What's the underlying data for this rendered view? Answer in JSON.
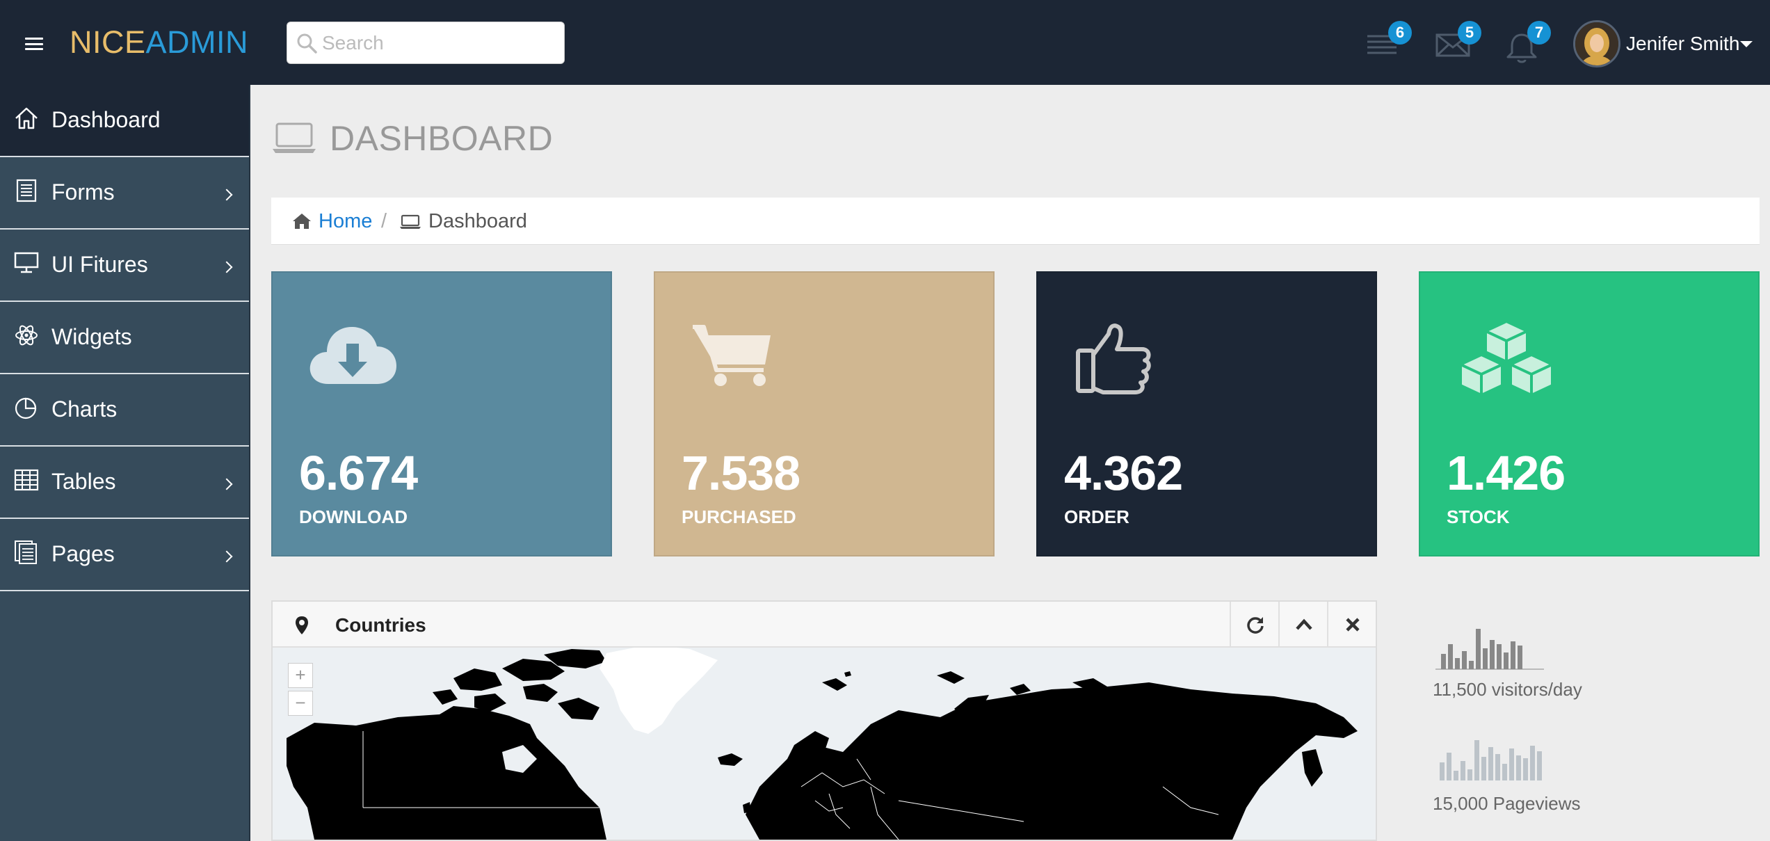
{
  "brand": {
    "part1": "NICE",
    "part2": "ADMIN"
  },
  "search": {
    "placeholder": "Search"
  },
  "header": {
    "tasks_badge": "6",
    "messages_badge": "5",
    "notifications_badge": "7",
    "user_name": "Jenifer Smith"
  },
  "sidebar": {
    "items": [
      {
        "label": "Dashboard",
        "icon": "home-icon",
        "active": true,
        "submenu": false
      },
      {
        "label": "Forms",
        "icon": "document-icon",
        "submenu": true
      },
      {
        "label": "UI Fitures",
        "icon": "desktop-icon",
        "submenu": true
      },
      {
        "label": "Widgets",
        "icon": "atom-icon",
        "submenu": false
      },
      {
        "label": "Charts",
        "icon": "pie-chart-icon",
        "submenu": false
      },
      {
        "label": "Tables",
        "icon": "table-icon",
        "submenu": true
      },
      {
        "label": "Pages",
        "icon": "pages-icon",
        "submenu": true
      }
    ]
  },
  "page": {
    "title": "DASHBOARD"
  },
  "breadcrumb": {
    "home": "Home",
    "separator": "/",
    "current": "Dashboard"
  },
  "tiles": [
    {
      "value": "6.674",
      "label": "DOWNLOAD",
      "icon": "cloud-download-icon",
      "color": "#5a8a9f"
    },
    {
      "value": "7.538",
      "label": "PURCHASED",
      "icon": "shopping-cart-icon",
      "color": "#d0b791"
    },
    {
      "value": "4.362",
      "label": "ORDER",
      "icon": "thumbs-up-icon",
      "color": "#1c2635"
    },
    {
      "value": "1.426",
      "label": "STOCK",
      "icon": "cubes-icon",
      "color": "#26c281"
    }
  ],
  "countries_panel": {
    "title": "Countries",
    "zoom_in": "+",
    "zoom_out": "−"
  },
  "stats": [
    {
      "text": "11,500 visitors/day"
    },
    {
      "text": "15,000 Pageviews"
    }
  ],
  "colors": {
    "header_bg": "#1c2635",
    "sidebar_bg": "#364b5b",
    "accent_blue": "#1692d4",
    "link_blue": "#1a7ed4"
  }
}
